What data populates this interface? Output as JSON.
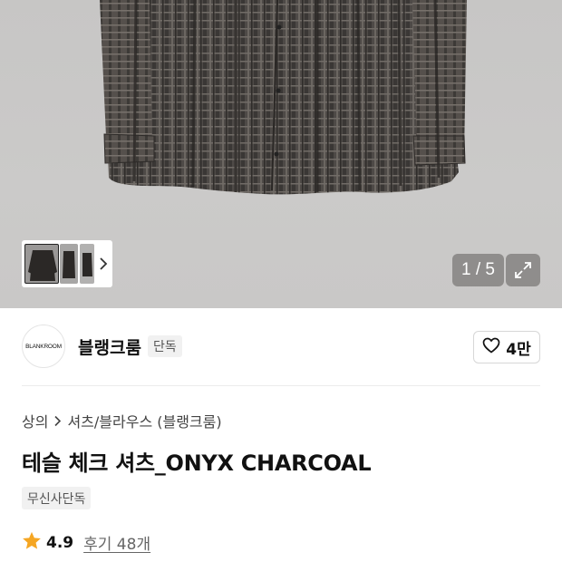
{
  "gallery": {
    "counter": "1 / 5",
    "colors": {
      "background": "#c8c7c6",
      "shirt_base": "#5a5652",
      "overlay": "#787674"
    }
  },
  "brand": {
    "logo_text": "BLANKROOM",
    "name": "블랭크룸",
    "badge": "단독"
  },
  "like": {
    "count": "4만"
  },
  "breadcrumb": {
    "items": [
      "상의",
      "셔츠/블라우스 (블랭크룸)"
    ]
  },
  "product": {
    "title": "테슬 체크 셔츠_ONYX CHARCOAL",
    "tag": "무신사단독"
  },
  "rating": {
    "value": "4.9",
    "reviews": "후기 48개",
    "star_color": "#f5a623"
  }
}
